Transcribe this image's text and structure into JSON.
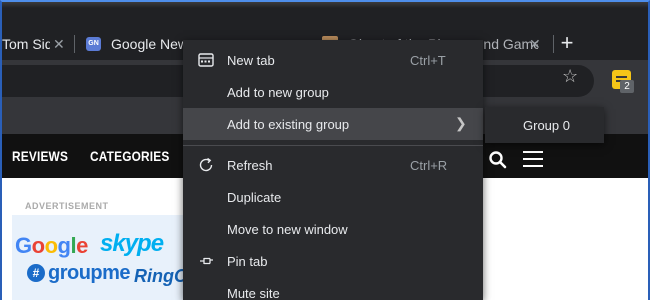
{
  "tabs": [
    {
      "title": "Tom Side"
    },
    {
      "title": "Google News",
      "favicon": "GN"
    },
    {
      "title": "Ghost of the Playground Games"
    }
  ],
  "toolbar": {
    "extension_badge": "2"
  },
  "site": {
    "nav": [
      "REVIEWS",
      "CATEGORIES"
    ]
  },
  "ad": {
    "label": "ADVERTISEMENT",
    "google": "Google",
    "skype": "skype",
    "groupme_icon": "#",
    "groupme": "groupme",
    "ring": "RingC"
  },
  "context_menu": {
    "items": [
      {
        "label": "New tab",
        "shortcut": "Ctrl+T",
        "icon": "new-tab-icon"
      },
      {
        "label": "Add to new group",
        "shortcut": ""
      },
      {
        "label": "Add to existing group",
        "shortcut": "",
        "submenu": true
      },
      {
        "label": "Refresh",
        "shortcut": "Ctrl+R",
        "icon": "refresh-icon"
      },
      {
        "label": "Duplicate",
        "shortcut": ""
      },
      {
        "label": "Move to new window",
        "shortcut": ""
      },
      {
        "label": "Pin tab",
        "shortcut": "",
        "icon": "pin-icon"
      },
      {
        "label": "Mute site",
        "shortcut": ""
      }
    ],
    "submenu": {
      "items": [
        "Group 0"
      ]
    }
  },
  "colors": {
    "window_border": "#2a5fb8",
    "tab_strip": "#202124",
    "toolbar": "#35363a",
    "menu_bg": "#292a2d",
    "menu_highlight": "#45464a"
  }
}
